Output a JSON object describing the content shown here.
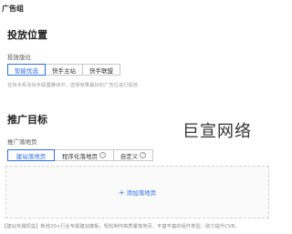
{
  "header": {
    "group_label": "广告组"
  },
  "placement": {
    "title": "投放位置",
    "field_label": "投放版位",
    "options": [
      {
        "label": "智能优选",
        "active": true
      },
      {
        "label": "快手主站",
        "active": false
      },
      {
        "label": "快手联盟",
        "active": false
      }
    ],
    "hint": "在快手系及快手联盟媒体中，选择效果最好的广告位进行投放"
  },
  "watermark": "巨宣网络",
  "target": {
    "title": "推广目标",
    "field_label": "推广落地页",
    "tabs": [
      {
        "label": "建站落地页",
        "active": true,
        "help": false
      },
      {
        "label": "程序化落地页",
        "active": false,
        "help": true
      },
      {
        "label": "自定义",
        "active": false,
        "help": true
      }
    ],
    "add_label": "添加落地页"
  },
  "footer": "【建站专属权益】新增20+行业专属建站模板，轻松制作高质量落地页，丰富丰富的组件类型，助力提升CVR，"
}
